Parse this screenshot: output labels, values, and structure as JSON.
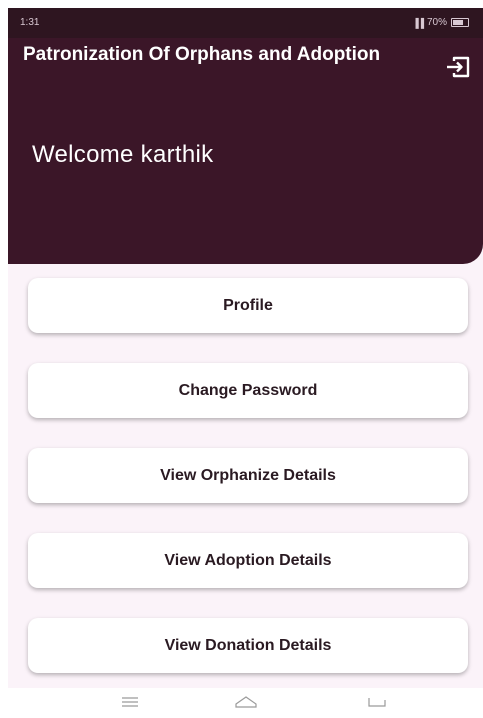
{
  "status_bar": {
    "time": "1:31",
    "signal": "▐▐",
    "battery_text": "70%"
  },
  "header": {
    "title": "Patronization Of Orphans and Adoption",
    "welcome": "Welcome karthik"
  },
  "menu": {
    "profile": "Profile",
    "change_password": "Change Password",
    "view_orphanize": "View Orphanize Details",
    "view_adoption": "View Adoption Details",
    "view_donation": "View Donation Details"
  },
  "colors": {
    "header_bg": "#3b1628",
    "page_bg": "#fbf3f9",
    "button_bg": "#ffffff",
    "button_text": "#2a1a22"
  },
  "icons": {
    "logout": "logout-icon",
    "nav_menu": "menu-icon",
    "nav_home": "home-icon",
    "nav_back": "back-icon"
  }
}
